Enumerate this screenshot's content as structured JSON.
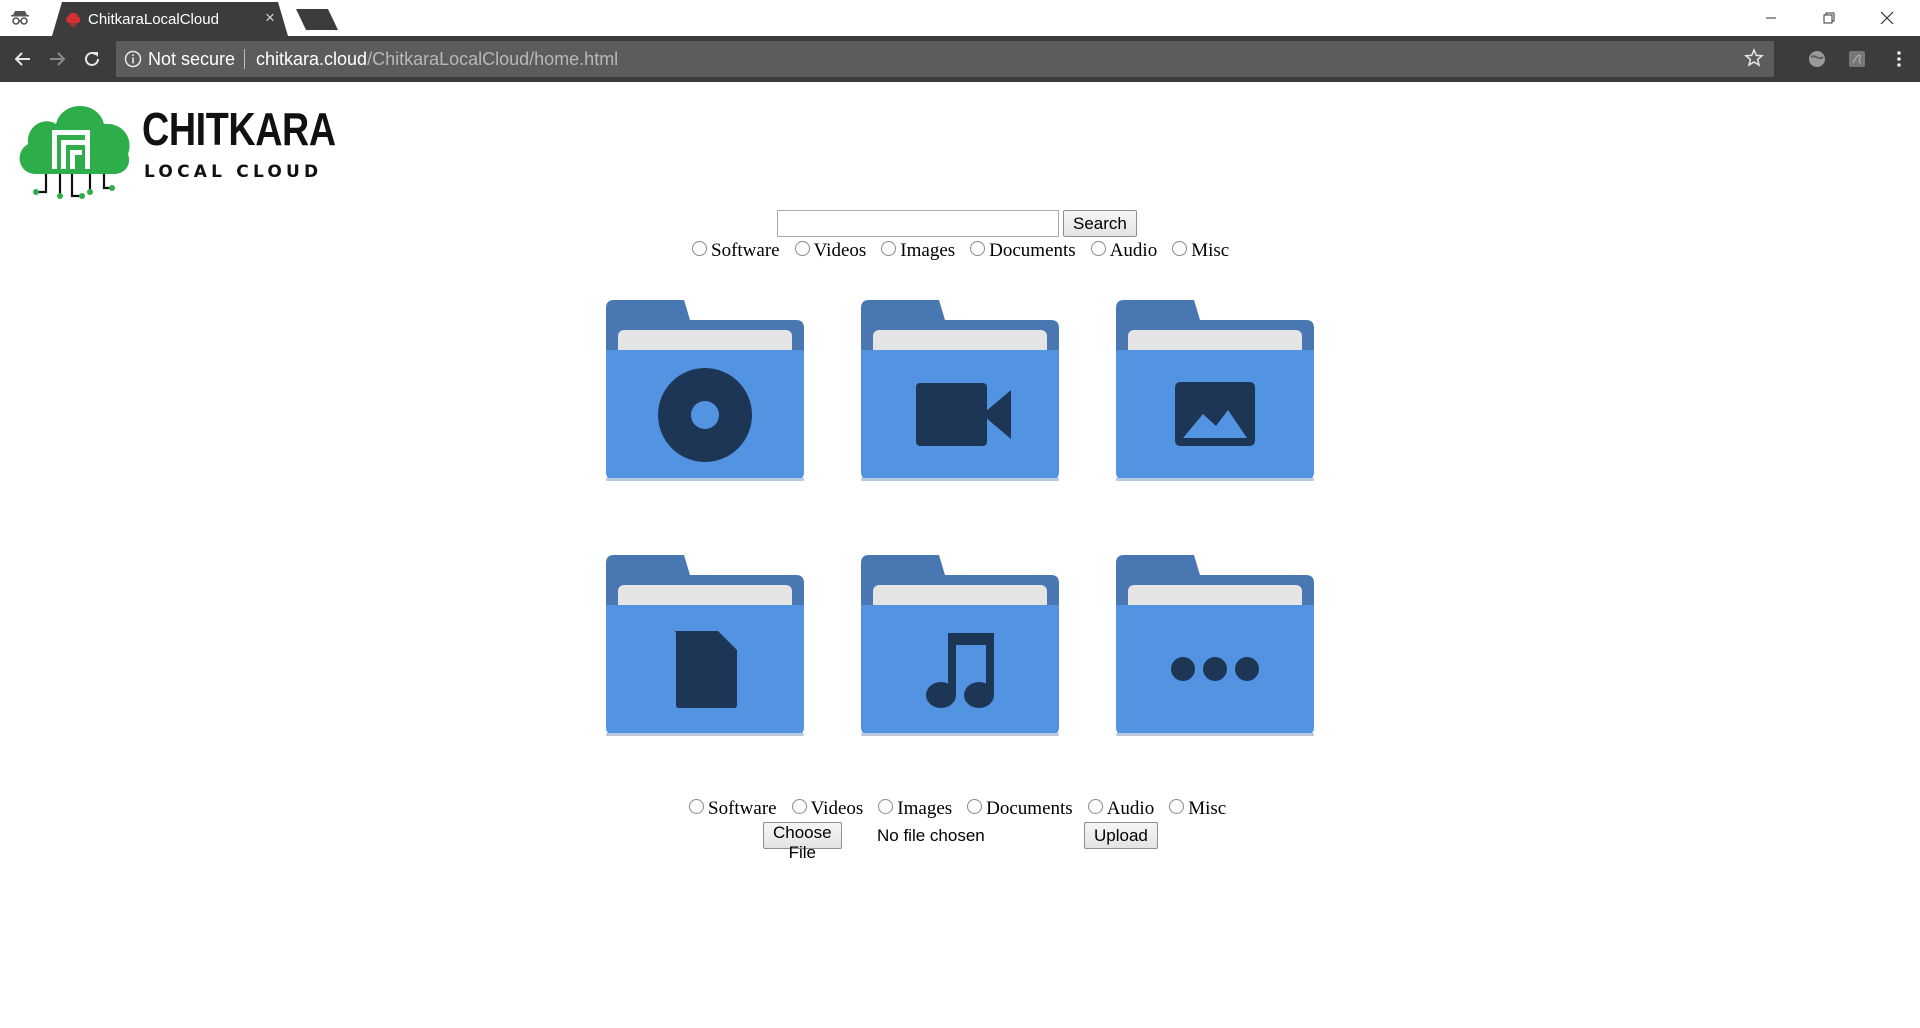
{
  "browser": {
    "tab_title": "ChitkaraLocalCloud",
    "tab_close": "×",
    "security_label": "Not secure",
    "url_host": "chitkara.cloud",
    "url_path": "/ChitkaraLocalCloud/home.html",
    "icons": {
      "incognito": "incognito-icon",
      "back": "back-arrow-icon",
      "forward": "forward-arrow-icon",
      "reload": "reload-icon",
      "info": "info-icon",
      "star": "star-icon",
      "menu": "kebab-menu-icon"
    }
  },
  "logo": {
    "title": "CHITKARA",
    "subtitle": "LOCAL CLOUD",
    "brand_green": "#2eae4a"
  },
  "search": {
    "value": "",
    "button_label": "Search"
  },
  "categories": [
    "Software",
    "Videos",
    "Images",
    "Documents",
    "Audio",
    "Misc"
  ],
  "folders": [
    {
      "icon": "disc-icon"
    },
    {
      "icon": "video-camera-icon"
    },
    {
      "icon": "image-icon"
    },
    {
      "icon": "document-icon"
    },
    {
      "icon": "music-note-icon"
    },
    {
      "icon": "more-dots-icon"
    }
  ],
  "upload": {
    "choose_label": "Choose File",
    "file_status": "No file chosen",
    "upload_label": "Upload"
  },
  "colors": {
    "folder_body": "#5294e2",
    "folder_back": "#4877b1",
    "folder_paper": "#e4e4e4",
    "folder_glyph": "#1e3656",
    "chrome_dark": "#3c3c3c"
  }
}
